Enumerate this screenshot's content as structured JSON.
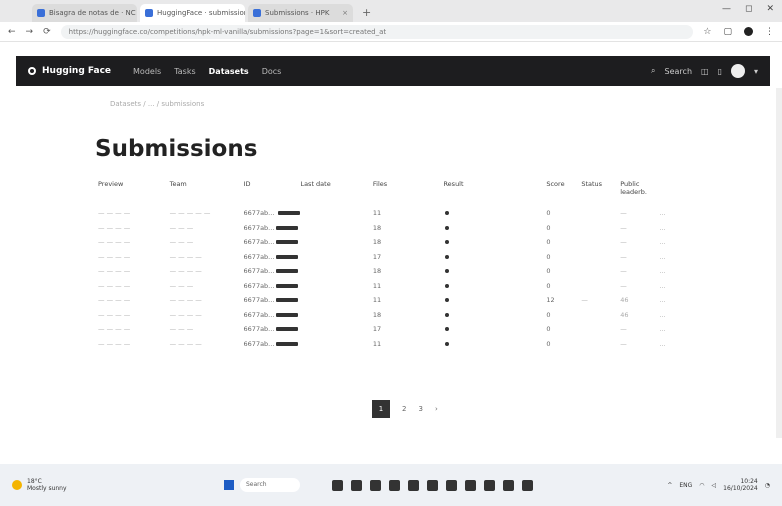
{
  "browser": {
    "tabs": [
      {
        "label": "Bisagra de notas de · NC",
        "active": false
      },
      {
        "label": "HuggingFace · submissions",
        "active": true
      },
      {
        "label": "Submissions · HPK",
        "active": false
      }
    ],
    "new_tab": "+",
    "window_controls": [
      "—",
      "◻",
      "✕"
    ],
    "nav": {
      "back": "←",
      "forward": "→",
      "reload": "⟳"
    },
    "url": "https://huggingface.co/competitions/hpk-ml-vanilla/submissions?page=1&sort=created_at"
  },
  "appnav": {
    "brand": "Hugging Face",
    "links": [
      {
        "label": "Models",
        "active": false
      },
      {
        "label": "Tasks",
        "active": false
      },
      {
        "label": "Datasets",
        "active": true
      },
      {
        "label": "Docs",
        "active": false
      }
    ],
    "search_icon": "search-icon",
    "search_label": "Search"
  },
  "breadcrumb": "Datasets / ... / submissions",
  "page_title": "Submissions",
  "table": {
    "headers": [
      "Preview",
      "Team",
      "ID",
      "Last date",
      "Files",
      "Result",
      "Score",
      "Status",
      "Public leaderb.",
      ""
    ],
    "rows": [
      [
        "— — — —",
        "— — — — —",
        "6677ab... ",
        "",
        "11",
        "",
        "0",
        "",
        "—",
        "..."
      ],
      [
        "— — — —",
        "— — —",
        "6677ab...",
        "",
        "18",
        "",
        "0",
        "",
        "—",
        "..."
      ],
      [
        "— — — —",
        "— — —",
        "6677ab...",
        "",
        "18",
        "",
        "0",
        "",
        "—",
        "..."
      ],
      [
        "— — — —",
        "— — — —",
        "6677ab...",
        "",
        "17",
        "",
        "0",
        "",
        "—",
        "..."
      ],
      [
        "— — — —",
        "— — — —",
        "6677ab...",
        "",
        "18",
        "",
        "0",
        "",
        "—",
        "..."
      ],
      [
        "— — — —",
        "— — —",
        "6677ab...",
        "",
        "11",
        "",
        "0",
        "",
        "—",
        "..."
      ],
      [
        "— — — —",
        "— — — —",
        "6677ab...",
        "",
        "11",
        "",
        "12",
        "—",
        "46",
        "..."
      ],
      [
        "— — — —",
        "— — — —",
        "6677ab...",
        "",
        "18",
        "",
        "0",
        "",
        "46",
        "..."
      ],
      [
        "— — — —",
        "— — —",
        "6677ab...",
        "",
        "17",
        "",
        "0",
        "",
        "—",
        "..."
      ],
      [
        "— — — —",
        "— — — —",
        "6677ab...",
        "",
        "11",
        "",
        "0",
        "",
        "—",
        "..."
      ]
    ]
  },
  "pagination": {
    "current": "1",
    "pages": [
      "2",
      "3",
      "›"
    ]
  },
  "taskbar": {
    "weather": "18°C",
    "weather_sub": "Mostly sunny",
    "search_placeholder": "Search",
    "time": "10:24",
    "date": "16/10/2024",
    "lang": "ENG"
  },
  "colors": {
    "navbar": "#1d1d1f",
    "page_bg": "#ffffff",
    "accent": "#333333"
  }
}
